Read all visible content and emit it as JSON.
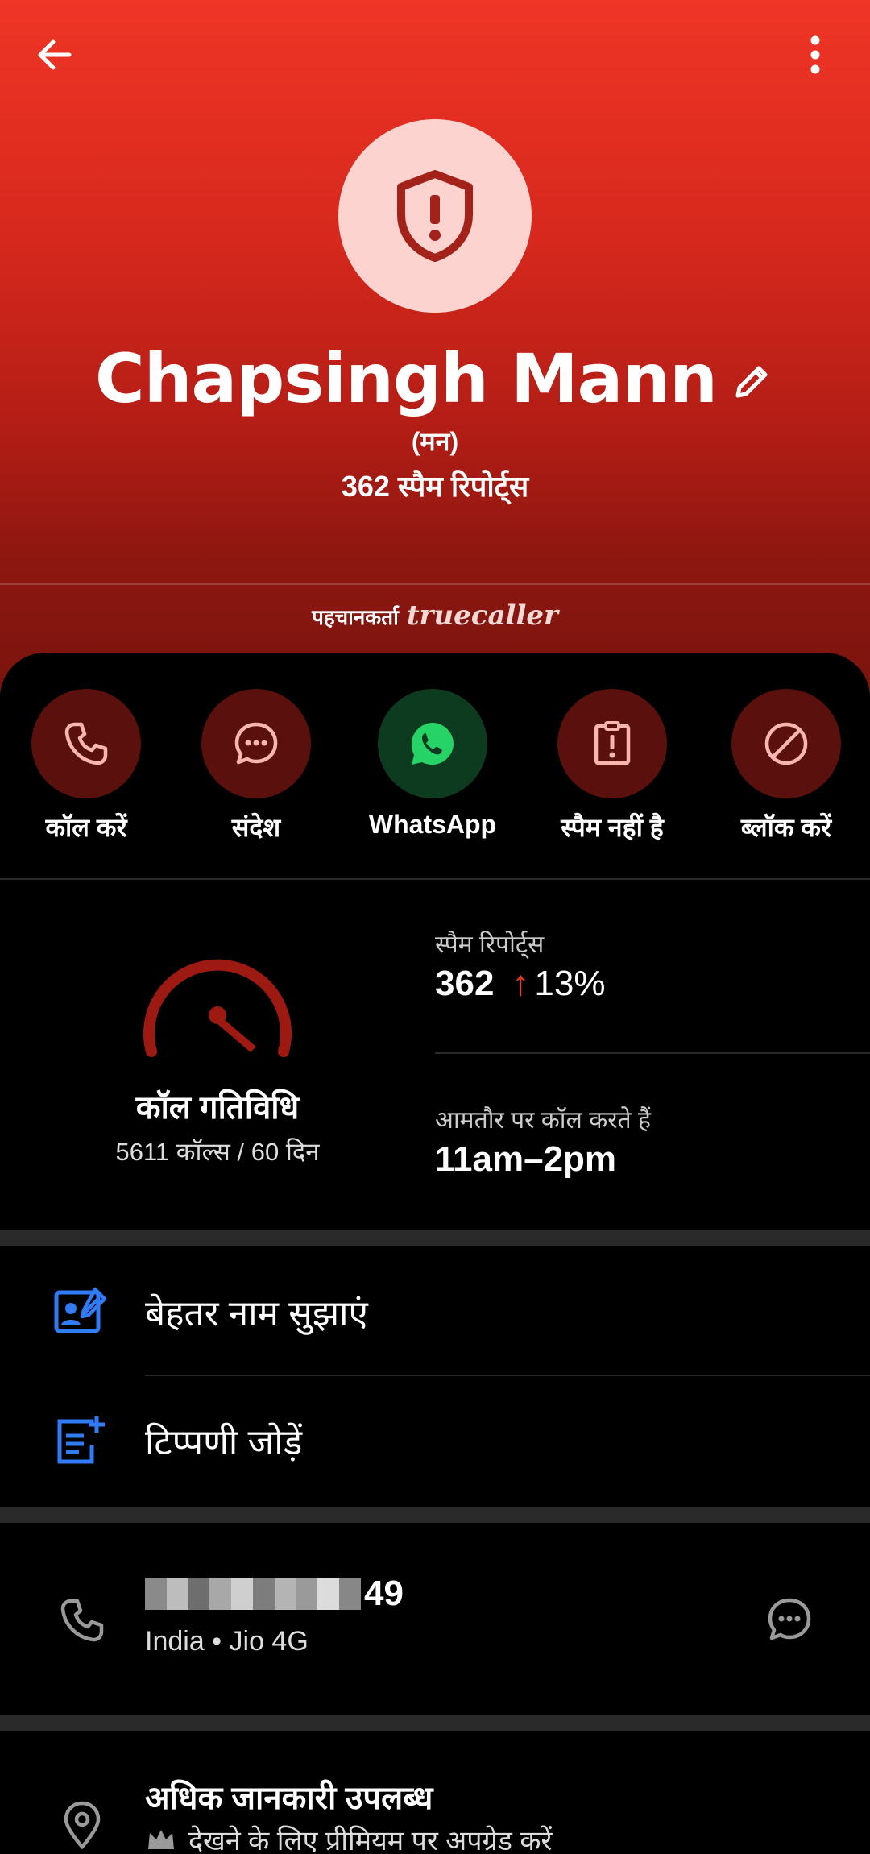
{
  "profile": {
    "name": "Chapsingh Mann",
    "alt_name": "(मन)",
    "spam_reports_header": "362 स्पैम रिपोर्ट्स",
    "identified_by_label": "पहचानकर्ता",
    "identified_by_brand": "truecaller"
  },
  "actions": [
    {
      "label": "कॉल करें",
      "icon": "phone-icon"
    },
    {
      "label": "संदेश",
      "icon": "message-icon"
    },
    {
      "label": "WhatsApp",
      "icon": "whatsapp-icon"
    },
    {
      "label": "स्पैम नहीं है",
      "icon": "not-spam-icon"
    },
    {
      "label": "ब्लॉक करें",
      "icon": "block-icon"
    }
  ],
  "activity": {
    "title": "कॉल गतिविधि",
    "subtitle": "5611 कॉल्स / 60 दिन",
    "spam_label": "स्पैम रिपोर्ट्स",
    "spam_value": "362",
    "spam_trend_arrow": "↑",
    "spam_trend": "13%",
    "usual_time_label": "आमतौर पर कॉल करते हैं",
    "usual_time_value": "11am–2pm"
  },
  "options": {
    "suggest_name": "बेहतर नाम सुझाएं",
    "add_note": "टिप्पणी जोड़ें"
  },
  "phone": {
    "number_visible_suffix": "49",
    "details": "India • Jio 4G"
  },
  "more_info": {
    "title": "अधिक जानकारी उपलब्ध",
    "subtitle": "देखने के लिए प्रीमियम पर अपग्रेड करें"
  },
  "colors": {
    "header_top": "#ef3526",
    "header_bottom": "#7a140e",
    "avatar_bg": "#fcd3cf",
    "action_circle": "#5a100c",
    "whatsapp_circle": "#0d3b1f",
    "accent_blue": "#2f7cf6",
    "gauge_red": "#9c1a12",
    "trend_red": "#ea3a2d"
  }
}
